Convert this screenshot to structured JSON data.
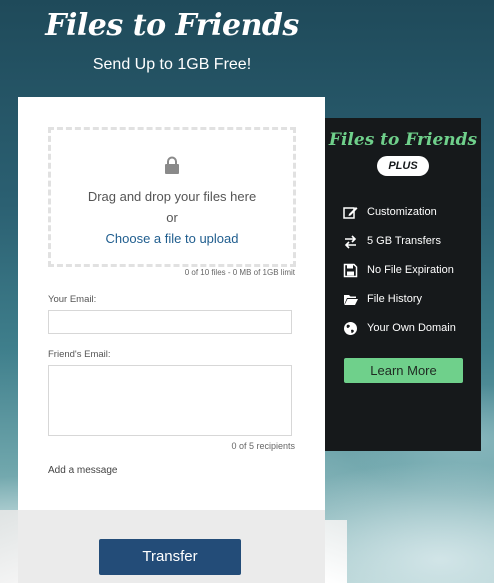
{
  "header": {
    "title": "Files to Friends",
    "subtitle": "Send Up to 1GB Free!"
  },
  "upload": {
    "drag_text": "Drag and drop your files here",
    "or_text": "or",
    "choose_text": "Choose a file to upload",
    "limit_text": "0 of 10 files - 0 MB of 1GB limit"
  },
  "form": {
    "your_email_label": "Your Email:",
    "your_email_value": "",
    "friends_email_label": "Friend's Email:",
    "friends_email_value": "",
    "recipients_text": "0 of 5 recipients",
    "add_message": "Add a message",
    "transfer_label": "Transfer"
  },
  "plus": {
    "title": "Files to Friends",
    "badge": "PLUS",
    "features": [
      {
        "icon": "edit-icon",
        "label": "Customization"
      },
      {
        "icon": "transfer-arrows-icon",
        "label": "5 GB Transfers"
      },
      {
        "icon": "floppy-disk-icon",
        "label": "No File Expiration"
      },
      {
        "icon": "folder-icon",
        "label": "File History"
      },
      {
        "icon": "globe-icon",
        "label": "Your Own Domain"
      }
    ],
    "learn_more": "Learn More"
  },
  "colors": {
    "accent_green": "#6fd08b",
    "button_blue": "#234c78",
    "link_blue": "#1f5d8e",
    "plus_bg": "#16191b"
  }
}
